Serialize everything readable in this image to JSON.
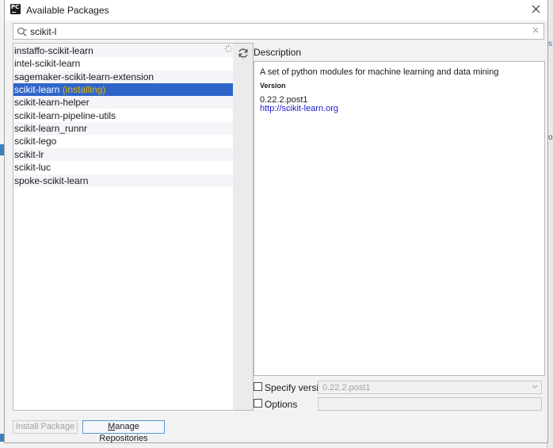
{
  "window": {
    "title": "Available Packages",
    "app_icon": "pycharm-icon",
    "app_icon_text": "PC",
    "close_icon": "close-icon"
  },
  "search": {
    "value": "scikit-l",
    "search_icon": "search-icon",
    "clear_icon": "clear-icon"
  },
  "packages": [
    {
      "name": "instaffo-scikit-learn",
      "tag": ""
    },
    {
      "name": "intel-scikit-learn",
      "tag": ""
    },
    {
      "name": "sagemaker-scikit-learn-extension",
      "tag": ""
    },
    {
      "name": "scikit-learn",
      "tag": "(installing)",
      "selected": true
    },
    {
      "name": "scikit-learn-helper",
      "tag": ""
    },
    {
      "name": "scikit-learn-pipeline-utils",
      "tag": ""
    },
    {
      "name": "scikit-learn_runnr",
      "tag": ""
    },
    {
      "name": "scikit-lego",
      "tag": ""
    },
    {
      "name": "scikit-lr",
      "tag": ""
    },
    {
      "name": "scikit-luc",
      "tag": ""
    },
    {
      "name": "spoke-scikit-learn",
      "tag": ""
    }
  ],
  "toolbar": {
    "refresh_icon": "refresh-icon",
    "spinner_icon": "loading-spinner-icon"
  },
  "description": {
    "label": "Description",
    "text": "A set of python modules for machine learning and data mining",
    "version_heading": "Version",
    "version": "0.22.2.post1",
    "link": "http://scikit-learn.org"
  },
  "specify_version": {
    "label": "Specify version",
    "checked": false,
    "value": "0.22.2.post1"
  },
  "options": {
    "label": "Options",
    "checked": false,
    "value": ""
  },
  "buttons": {
    "install": "Install Package",
    "manage_repositories_underlined": "M",
    "manage_repositories_rest": "anage Repositories"
  }
}
